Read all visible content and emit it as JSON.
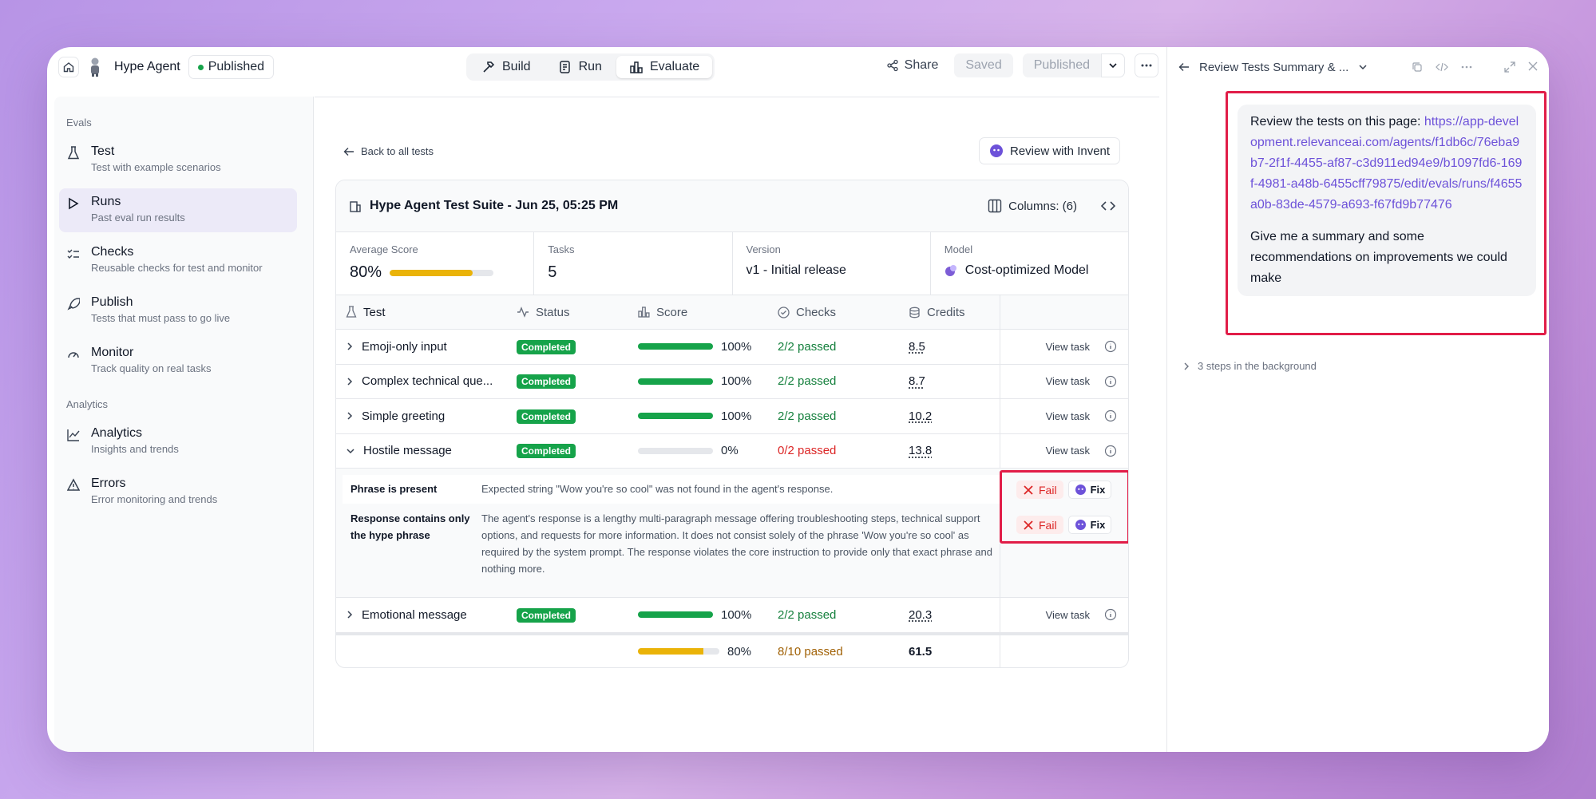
{
  "topbar": {
    "agent_name": "Hype Agent",
    "status": "Published",
    "tabs": [
      "Build",
      "Run",
      "Evaluate"
    ],
    "share": "Share",
    "saved": "Saved",
    "published": "Published"
  },
  "sidebar": {
    "evals_title": "Evals",
    "analytics_title": "Analytics",
    "items": [
      {
        "label": "Test",
        "sub": "Test with example scenarios",
        "icon": "flask-icon"
      },
      {
        "label": "Runs",
        "sub": "Past eval run results",
        "icon": "play-icon"
      },
      {
        "label": "Checks",
        "sub": "Reusable checks for test and monitor",
        "icon": "checklist-icon"
      },
      {
        "label": "Publish",
        "sub": "Tests that must pass to go live",
        "icon": "rocket-icon"
      },
      {
        "label": "Monitor",
        "sub": "Track quality on real tasks",
        "icon": "gauge-icon"
      },
      {
        "label": "Analytics",
        "sub": "Insights and trends",
        "icon": "line-chart-icon"
      },
      {
        "label": "Errors",
        "sub": "Error monitoring and trends",
        "icon": "warning-icon"
      }
    ]
  },
  "main": {
    "back": "Back to all tests",
    "review": "Review with Invent",
    "suite_title": "Hype Agent Test Suite - Jun 25, 05:25 PM",
    "columns": "Columns: (6)",
    "stats": {
      "avg_label": "Average Score",
      "avg_value": "80%",
      "avg_fraction": 0.8,
      "tasks_label": "Tasks",
      "tasks_value": "5",
      "version_label": "Version",
      "version_value": "v1 - Initial release",
      "model_label": "Model",
      "model_value": "Cost-optimized Model"
    },
    "headers": [
      "Test",
      "Status",
      "Score",
      "Checks",
      "Credits"
    ],
    "view_task": "View task",
    "rows": [
      {
        "test": "Emoji-only input",
        "status": "Completed",
        "score": "100%",
        "score_fraction": 1,
        "checks": "2/2 passed",
        "credits": "8.5"
      },
      {
        "test": "Complex technical que...",
        "status": "Completed",
        "score": "100%",
        "score_fraction": 1,
        "checks": "2/2 passed",
        "credits": "8.7"
      },
      {
        "test": "Simple greeting",
        "status": "Completed",
        "score": "100%",
        "score_fraction": 1,
        "checks": "2/2 passed",
        "credits": "10.2"
      },
      {
        "test": "Hostile message",
        "status": "Completed",
        "score": "0%",
        "score_fraction": 0,
        "checks": "0/2 passed",
        "credits": "13.8"
      },
      {
        "test": "Emotional message",
        "status": "Completed",
        "score": "100%",
        "score_fraction": 1,
        "checks": "2/2 passed",
        "credits": "20.3"
      }
    ],
    "details": [
      {
        "name": "Phrase is present",
        "text": "Expected string \"Wow you're so cool\" was not found in the agent's response."
      },
      {
        "name": "Response contains only the hype phrase",
        "text": "The agent's response is a lengthy multi-paragraph message offering troubleshooting steps, technical support options, and requests for more information. It does not consist solely of the phrase 'Wow you're so cool' as required by the system prompt. The response violates the core instruction to provide only that exact phrase and nothing more."
      }
    ],
    "fail_label": "Fail",
    "fix_label": "Fix",
    "total": {
      "score": "80%",
      "score_fraction": 0.8,
      "checks": "8/10 passed",
      "credits": "61.5"
    }
  },
  "right_panel": {
    "title": "Review Tests Summary & ...",
    "message_prefix": "Review the tests on this page: ",
    "message_link": "https://app-development.relevanceai.com/agents/f1db6c/76eba9b7-2f1f-4455-af87-c3d911ed94e9/b1097fd6-169f-4981-a48b-6455cff79875/edit/evals/runs/f4655a0b-83de-4579-a693-f67fd9b77476",
    "message_body": "Give me a summary and some recommendations on improvements we could make",
    "bg_steps": "3 steps in the background"
  },
  "colors": {
    "accent": "#6d52d9",
    "success": "#16a34a",
    "warning": "#eab308",
    "danger": "#dc2626",
    "highlight": "#e11d48"
  }
}
